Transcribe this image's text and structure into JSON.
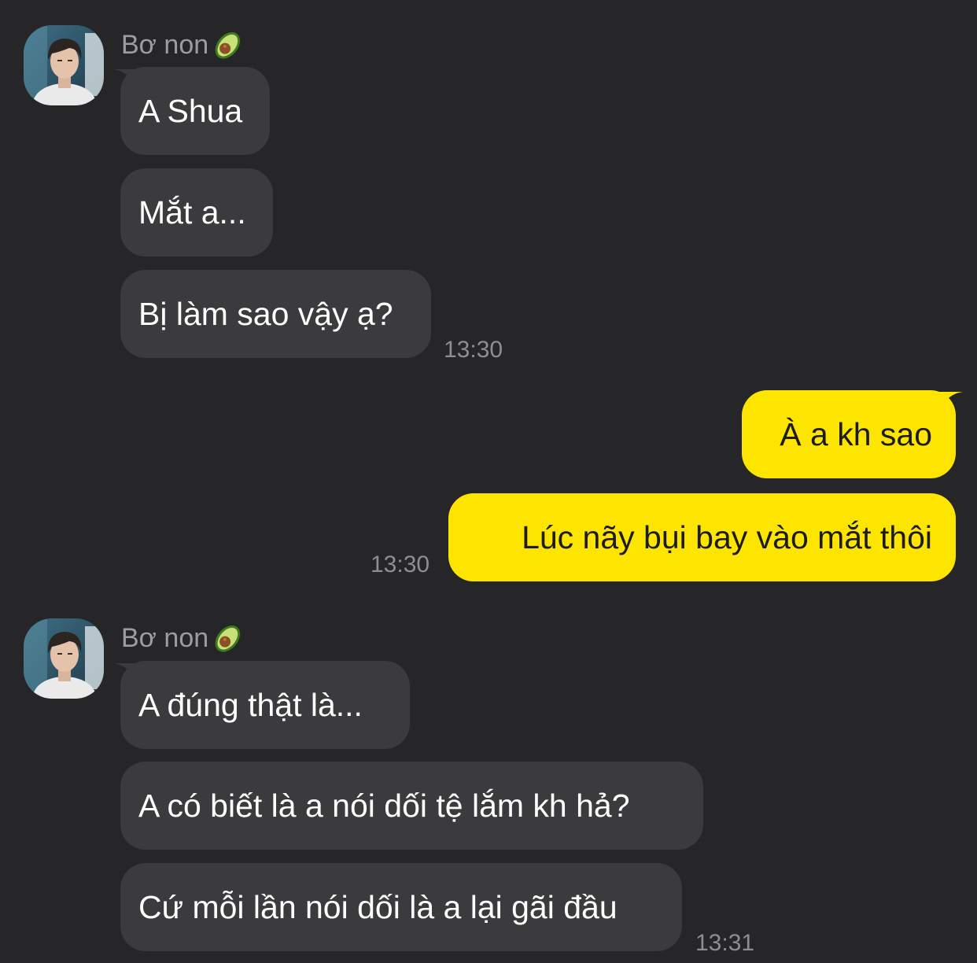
{
  "chat": {
    "groups": [
      {
        "sender": "Bơ non",
        "sender_emoji": "avocado-icon",
        "messages": [
          "A Shua",
          "Mắt a...",
          "Bị làm sao vậy ạ?"
        ],
        "time": "13:30"
      },
      {
        "sender": "me",
        "messages": [
          "À a kh sao",
          "Lúc nãy bụi bay vào mắt thôi"
        ],
        "time": "13:30"
      },
      {
        "sender": "Bơ non",
        "sender_emoji": "avocado-icon",
        "messages": [
          "A đúng thật là...",
          "A có biết là a nói dối tệ lắm kh hả?",
          "Cứ mỗi lần nói dối là a lại gãi đầu"
        ],
        "time": "13:31"
      }
    ]
  },
  "colors": {
    "background": "#262628",
    "incoming_bubble": "#3b3b3d",
    "outgoing_bubble": "#fee500",
    "timestamp": "#8e8e90",
    "sender_name": "#9d9d9f"
  }
}
